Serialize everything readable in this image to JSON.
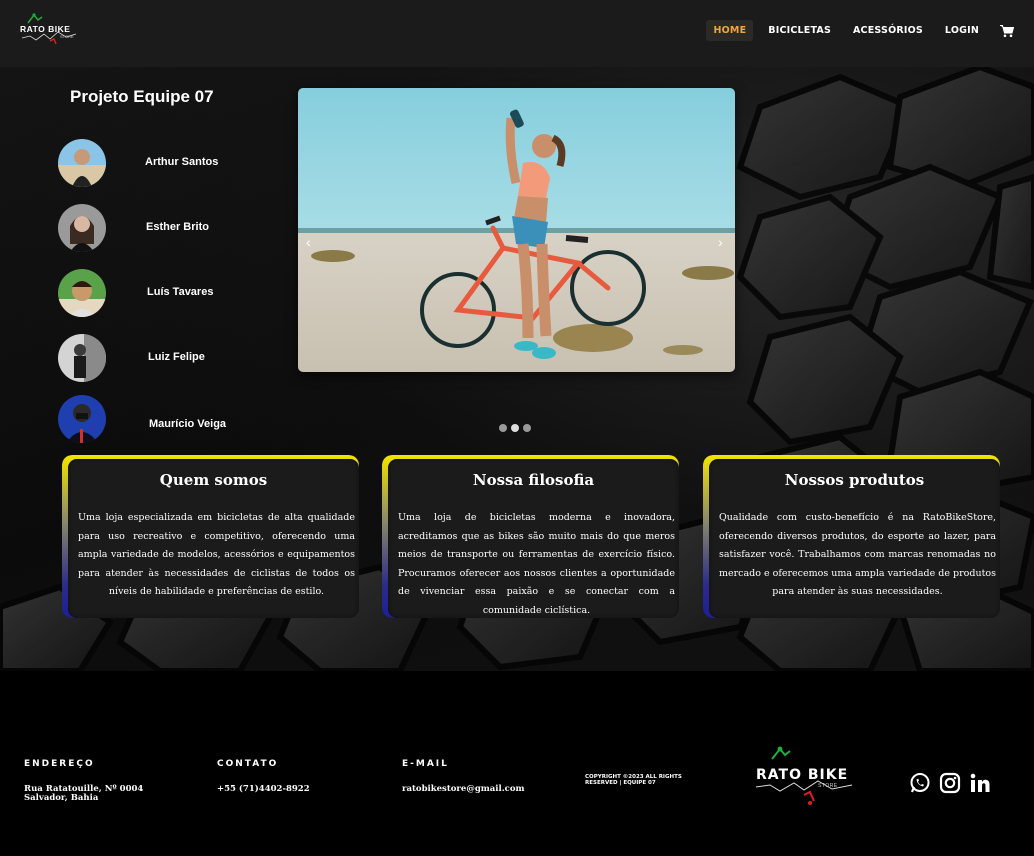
{
  "navbar": {
    "logo_text": "RATO BIKE",
    "logo_sub": "STORE",
    "items": [
      {
        "label": "HOME",
        "active": true
      },
      {
        "label": "BICICLETAS",
        "active": false
      },
      {
        "label": "ACESSÓRIOS",
        "active": false
      },
      {
        "label": "LOGIN",
        "active": false
      }
    ],
    "cart_icon": "cart-icon"
  },
  "team": {
    "title": "Projeto Equipe 07",
    "members": [
      {
        "name": "Arthur Santos"
      },
      {
        "name": "Esther Brito"
      },
      {
        "name": "Luís Tavares"
      },
      {
        "name": "Luiz Felipe"
      },
      {
        "name": "Maurício Veiga"
      }
    ]
  },
  "carousel": {
    "prev_icon": "‹",
    "next_icon": "›",
    "slide_count": 3,
    "active_index": 1
  },
  "cards": [
    {
      "title": "Quem somos",
      "text": "Uma loja especializada em bicicletas de alta qualidade para uso recreativo e competitivo, oferecendo uma ampla variedade de modelos, acessórios e equipamentos para atender às necessidades de ciclistas de todos os níveis de habilidade e preferências de estilo."
    },
    {
      "title": "Nossa filosofia",
      "text": "Uma loja de bicicletas moderna e inovadora, acreditamos que as bikes são muito mais do que meros meios de transporte ou ferramentas de exercício físico. Procuramos oferecer aos nossos clientes a oportunidade de vivenciar essa paixão e se conectar com a comunidade ciclística."
    },
    {
      "title": "Nossos produtos",
      "text": "Qualidade com custo-benefício é na RatoBikeStore, oferecendo diversos produtos, do esporte ao lazer, para satisfazer você. Trabalhamos com marcas renomadas no mercado e oferecemos uma ampla variedade de produtos para atender às suas necessidades."
    }
  ],
  "footer": {
    "address_label": "ENDEREÇO",
    "address_line1": "Rua Ratatouille, Nº 0004",
    "address_line2": "Salvador, Bahia",
    "contact_label": "CONTATO",
    "contact_value": "+55 (71)4402-8922",
    "email_label": "E-MAIL",
    "email_value": "ratobikestore@gmail.com",
    "copyright": "COPYRIGHT ©2023 ALL RIGHTS RESERVED | EQUIPE 07",
    "logo_text": "RATO BIKE",
    "logo_sub": "STORE",
    "social": [
      "whatsapp-icon",
      "instagram-icon",
      "linkedin-icon"
    ]
  },
  "colors": {
    "accent": "#f0a63a",
    "card_border_top": "#f2e400",
    "card_border_bottom": "#1e1e9a",
    "logo_green": "#1fae3b",
    "logo_red": "#e02020"
  }
}
